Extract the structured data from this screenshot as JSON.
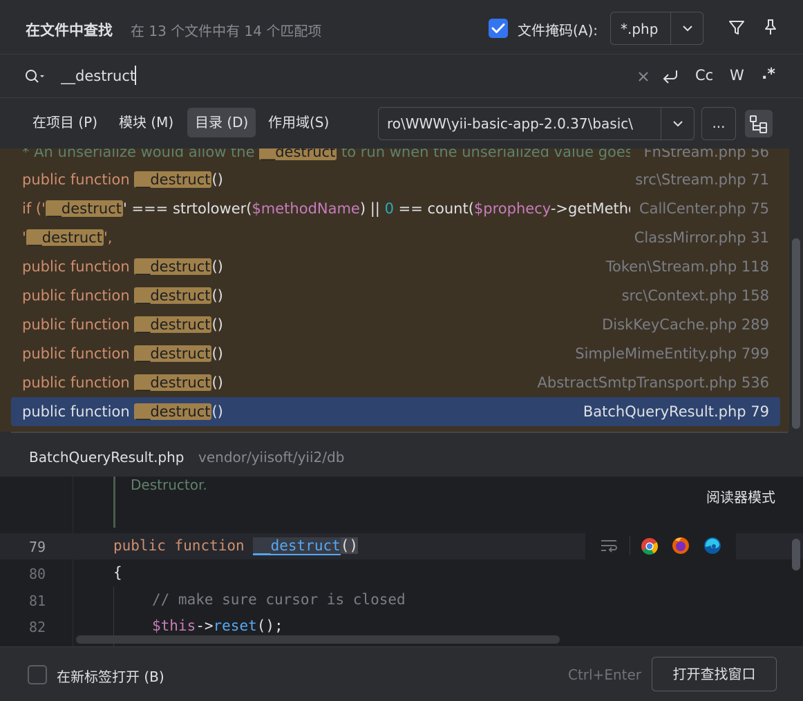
{
  "header": {
    "title": "在文件中查找",
    "subtitle": "在 13 个文件中有 14 个匹配项",
    "file_mask_label": "文件掩码(A):",
    "file_mask_checked": true,
    "file_mask_value": "*.php"
  },
  "search": {
    "query": "__destruct",
    "options": {
      "case": "Cc",
      "words": "W",
      "regex": ".*"
    }
  },
  "scope": {
    "tabs": [
      {
        "label": "在项目 (P)",
        "active": false
      },
      {
        "label": "模块 (M)",
        "active": false
      },
      {
        "label": "目录 (D)",
        "active": true
      },
      {
        "label": "作用域(S)",
        "active": false
      }
    ],
    "directory": "ro\\WWW\\yii-basic-app-2.0.37\\basic\\",
    "browse_label": "..."
  },
  "results": [
    {
      "pre": "* An unserialize would allow the ",
      "match": "__destruct",
      "post": " to run when the unserialized value goes o",
      "file": "FnStream.php 56",
      "type": "comment"
    },
    {
      "pre": "public function ",
      "match": "__destruct",
      "post": "()",
      "file": "src\\Stream.php 71",
      "type": "fn"
    },
    {
      "pre": "if ('",
      "match": "__destruct",
      "post_a": "' === strtolower(",
      "var1": "$methodName",
      "post_b": ") || ",
      "num": "0",
      "post_c": " == count(",
      "var2": "$prophecy",
      "post_d": "->getMethod",
      "file": "CallCenter.php 75",
      "type": "if"
    },
    {
      "pre": "'",
      "match": "__destruct",
      "post": "',",
      "file": "ClassMirror.php 31",
      "type": "str"
    },
    {
      "pre": "public function ",
      "match": "__destruct",
      "post": "()",
      "file": "Token\\Stream.php 118",
      "type": "fn"
    },
    {
      "pre": "public function ",
      "match": "__destruct",
      "post": "()",
      "file": "src\\Context.php 158",
      "type": "fn"
    },
    {
      "pre": "public function ",
      "match": "__destruct",
      "post": "()",
      "file": "DiskKeyCache.php 289",
      "type": "fn"
    },
    {
      "pre": "public function ",
      "match": "__destruct",
      "post": "()",
      "file": "SimpleMimeEntity.php 799",
      "type": "fn"
    },
    {
      "pre": "public function ",
      "match": "__destruct",
      "post": "()",
      "file": "AbstractSmtpTransport.php 536",
      "type": "fn"
    },
    {
      "pre": "public function ",
      "match": "__destruct",
      "post": "()",
      "file": "BatchQueryResult.php 79",
      "type": "fn",
      "selected": true
    }
  ],
  "preview": {
    "file_name": "BatchQueryResult.php",
    "file_path": "vendor/yiisoft/yii2/db",
    "reader_mode": "阅读器模式",
    "doc_text": "Destructor.",
    "lines": [
      {
        "number": "79",
        "tokens": {
          "kw1": "public",
          "kw2": "function",
          "name": "__destruct",
          "parens": "()"
        }
      },
      {
        "number": "80",
        "text": "{"
      },
      {
        "number": "81",
        "text": "// make sure cursor is closed"
      },
      {
        "number": "82",
        "tokens": {
          "var": "$this",
          "arrow": "->",
          "method": "reset",
          "rest": "();"
        }
      }
    ]
  },
  "footer": {
    "new_tab_label": "在新标签打开 (B)",
    "new_tab_checked": false,
    "shortcut": "Ctrl+Enter",
    "open_button": "打开查找窗口"
  }
}
